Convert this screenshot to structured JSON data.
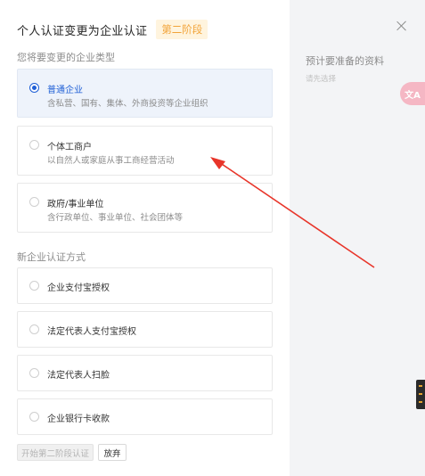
{
  "dialog": {
    "title": "个人认证变更为企业认证",
    "stage_tag": "第二阶段",
    "enterprise_type_label": "您将要变更的企业类型",
    "enterprise_types": [
      {
        "title": "普通企业",
        "desc": "含私营、国有、集体、外商投资等企业组织",
        "selected": true
      },
      {
        "title": "个体工商户",
        "desc": "以自然人或家庭从事工商经营活动",
        "selected": false
      },
      {
        "title": "政府/事业单位",
        "desc": "含行政单位、事业单位、社会团体等",
        "selected": false
      }
    ],
    "auth_method_label": "新企业认证方式",
    "auth_methods": [
      {
        "title": "企业支付宝授权"
      },
      {
        "title": "法定代表人支付宝授权"
      },
      {
        "title": "法定代表人扫脸"
      },
      {
        "title": "企业银行卡收款"
      }
    ],
    "start_button": "开始第二阶段认证",
    "cancel_button": "放弃"
  },
  "right_panel": {
    "title": "预计要准备的资料",
    "hint": "请先选择"
  },
  "translate_button": "文A",
  "colors": {
    "accent": "#1f5fd6",
    "stage_tag_bg": "#fff4de",
    "stage_tag_text": "#f2a43a",
    "arrow": "#e8352a"
  }
}
